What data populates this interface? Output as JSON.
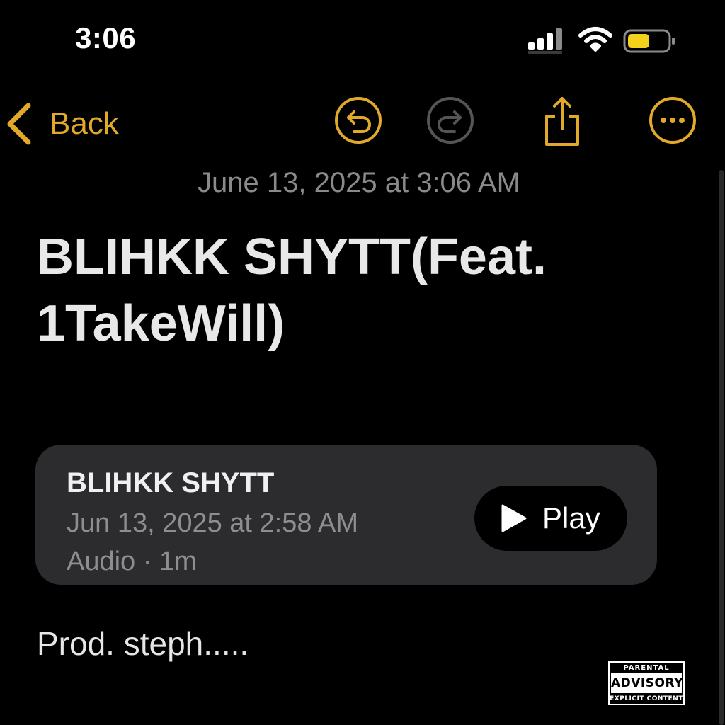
{
  "status_bar": {
    "time": "3:06",
    "signal_icon": "cellular-signal-icon",
    "wifi_icon": "wifi-icon",
    "battery_icon": "battery-low-icon",
    "battery_color": "#f2d21b"
  },
  "nav": {
    "back_label": "Back",
    "accent_color": "#e0a92a",
    "icons": [
      "undo-icon",
      "redo-icon",
      "share-icon",
      "more-icon"
    ]
  },
  "note": {
    "date": "June 13, 2025 at 3:06 AM",
    "title": "BLIHKK SHYTT(Feat. 1TakeWill)",
    "body": "Prod. steph....."
  },
  "audio": {
    "title": "BLIHKK SHYTT",
    "date": "Jun 13, 2025 at 2:58 AM",
    "meta": "Audio · 1m",
    "play_label": "Play"
  },
  "advisory": {
    "top": "PARENTAL",
    "middle": "ADVISORY",
    "bottom": "EXPLICIT CONTENT"
  }
}
